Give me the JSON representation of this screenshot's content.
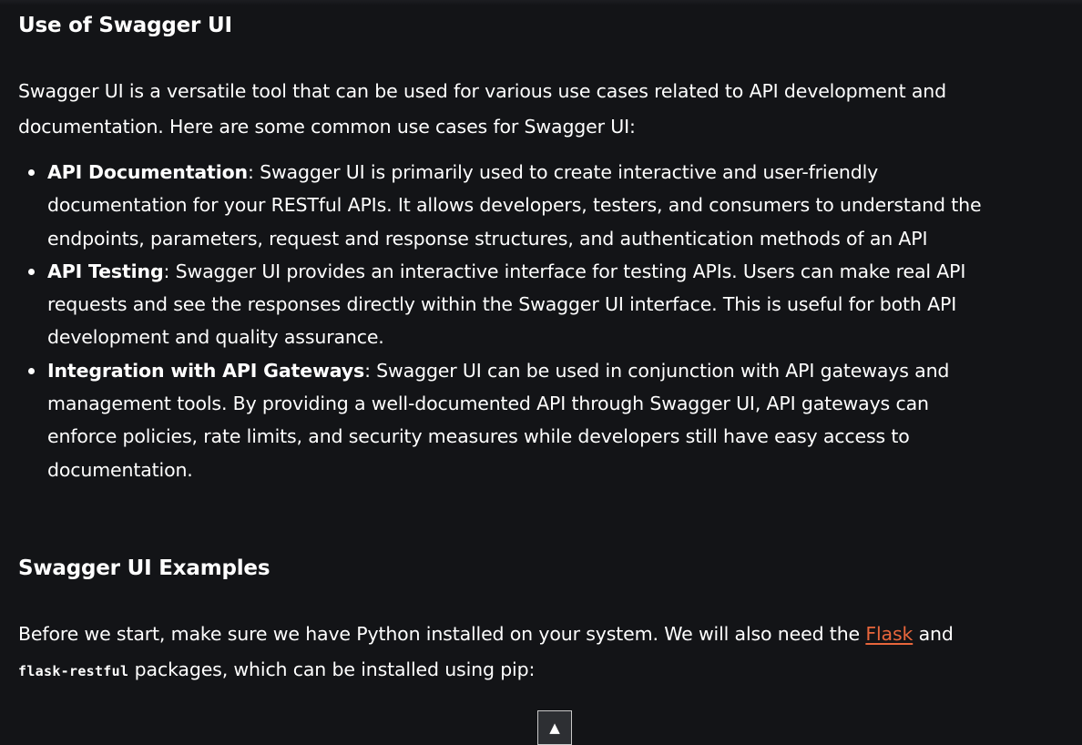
{
  "section_use": {
    "heading": "Use of Swagger UI",
    "intro": "Swagger UI is a versatile tool that can be used for various use cases related to API development and documentation. Here are some common use cases for Swagger UI:",
    "items": [
      {
        "term": "API Documentation",
        "text": ": Swagger UI is primarily used to create interactive and user-friendly documentation for your RESTful APIs. It allows developers, testers, and consumers to understand the endpoints, parameters, request and response structures, and authentication methods of an API"
      },
      {
        "term": "API Testing",
        "text": ": Swagger UI provides an interactive interface for testing APIs. Users can make real API requests and see the responses directly within the Swagger UI interface. This is useful for both API development and quality assurance."
      },
      {
        "term": "Integration with API Gateways",
        "text": ": Swagger UI can be used in conjunction with API gateways and management tools. By providing a well-documented API through Swagger UI, API gateways can enforce policies, rate limits, and security measures while developers still have easy access to documentation."
      }
    ]
  },
  "section_examples": {
    "heading": "Swagger UI Examples",
    "before_text_1": "Before we start, make sure we have Python installed on your system. We will also need the ",
    "flask_link": "Flask",
    "before_text_2": " and ",
    "code_package": "flask-restful",
    "before_text_3": " packages, which can be installed using pip:"
  },
  "scroll_top": {
    "icon": "up-triangle-icon",
    "glyph": "▲"
  },
  "colors": {
    "background": "#131417",
    "text": "#ffffff",
    "link": "#e8663c"
  }
}
